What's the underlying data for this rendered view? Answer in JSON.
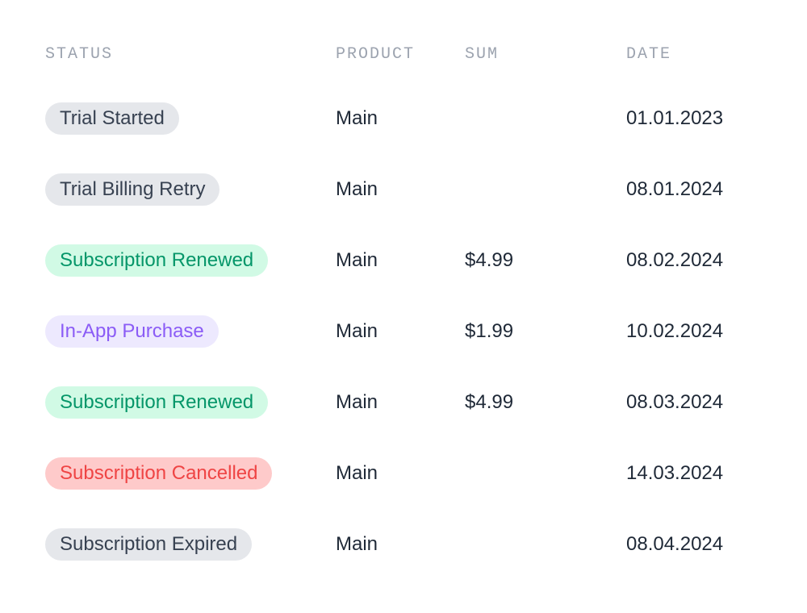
{
  "columns": {
    "status": "STATUS",
    "product": "PRODUCT",
    "sum": "SUM",
    "date": "DATE"
  },
  "rows": [
    {
      "status": "Trial Started",
      "statusType": "gray",
      "product": "Main",
      "sum": "",
      "date": "01.01.2023"
    },
    {
      "status": "Trial Billing Retry",
      "statusType": "gray",
      "product": "Main",
      "sum": "",
      "date": "08.01.2024"
    },
    {
      "status": "Subscription Renewed",
      "statusType": "green",
      "product": "Main",
      "sum": "$4.99",
      "date": "08.02.2024"
    },
    {
      "status": "In-App Purchase",
      "statusType": "purple",
      "product": "Main",
      "sum": "$1.99",
      "date": "10.02.2024"
    },
    {
      "status": "Subscription Renewed",
      "statusType": "green",
      "product": "Main",
      "sum": "$4.99",
      "date": "08.03.2024"
    },
    {
      "status": "Subscription Cancelled",
      "statusType": "red",
      "product": "Main",
      "sum": "",
      "date": "14.03.2024"
    },
    {
      "status": "Subscription Expired",
      "statusType": "gray",
      "product": "Main",
      "sum": "",
      "date": "08.04.2024"
    }
  ]
}
